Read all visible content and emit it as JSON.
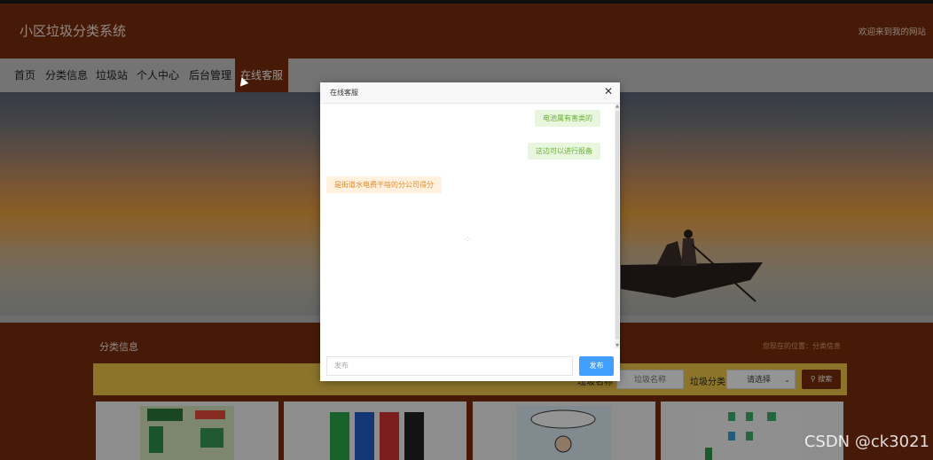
{
  "header": {
    "site_title": "小区垃圾分类系统",
    "welcome": "欢迎来到我的网站"
  },
  "nav": {
    "items": [
      "首页",
      "分类信息",
      "垃圾站",
      "个人中心",
      "后台管理",
      "在线客服"
    ],
    "active_index": 5
  },
  "section": {
    "title": "分类信息",
    "breadcrumb": "您现在的位置：分类信息"
  },
  "search": {
    "name_label": "垃圾名称",
    "name_placeholder": "垃圾名称",
    "category_label": "垃圾分类",
    "category_selected": "请选择",
    "button_label": "搜索"
  },
  "chat_dialog": {
    "title": "在线客服",
    "messages": [
      {
        "from": "me",
        "text": "电池属有害类的"
      },
      {
        "from": "me",
        "text": "这边可以进行报备"
      },
      {
        "from": "them",
        "text": "是街道水电费干啥的分公司得分"
      }
    ],
    "input_placeholder": "发布",
    "send_label": "发布"
  },
  "cards": [
    {
      "icon": "garbage-poster-image"
    },
    {
      "icon": "garbage-bins-image"
    },
    {
      "icon": "classification-cartoon-image"
    },
    {
      "icon": "process-diagram-image"
    }
  ],
  "watermark": "CSDN @ck3021",
  "colors": {
    "brand_brown": "#7b2e0d",
    "search_bar_yellow": "#f2c84a",
    "send_blue": "#409eff",
    "my_msg_bg": "#e9f6de",
    "their_msg_bg": "#fff1de"
  }
}
